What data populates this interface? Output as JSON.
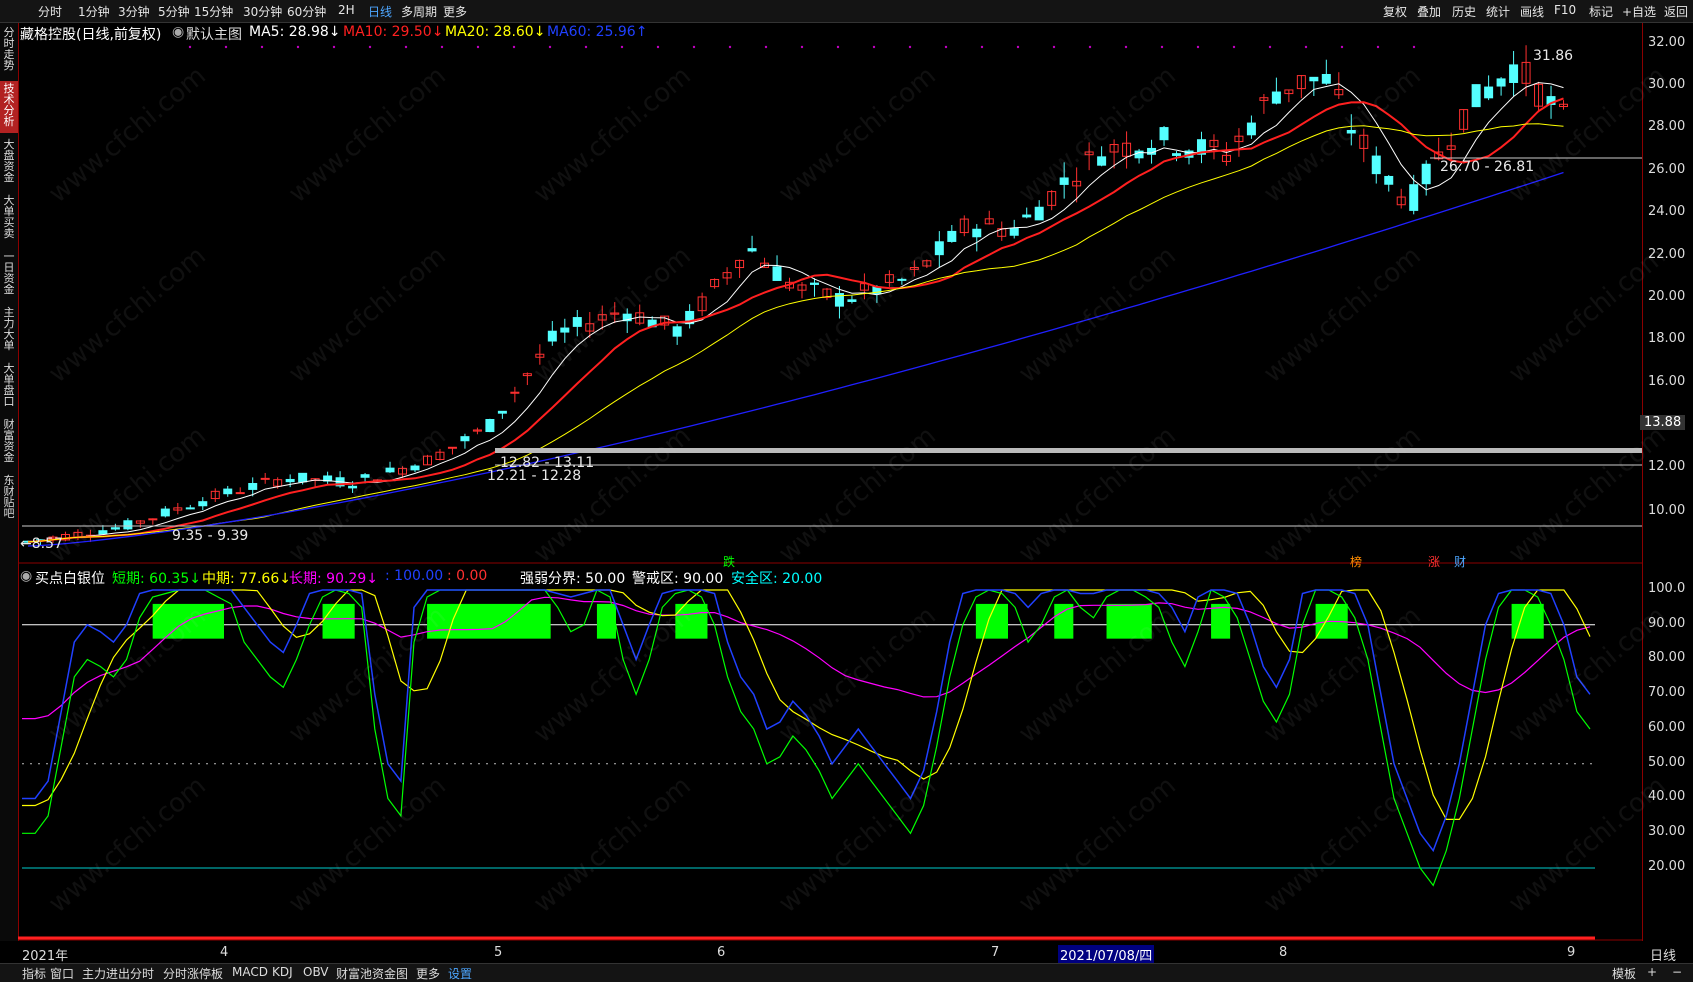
{
  "toolbar": {
    "left_items": [
      "分时",
      "1分钟",
      "3分钟",
      "5分钟",
      "15分钟",
      "30分钟",
      "60分钟",
      "2H",
      "日线",
      "多周期",
      "更多"
    ],
    "active": "日线",
    "right_items": [
      "复权",
      "叠加",
      "历史",
      "统计",
      "画线",
      "F10",
      "标记",
      "+自选",
      "返回"
    ]
  },
  "side_tabs": [
    "分时走势",
    "技术分析",
    "大盘资金",
    "大单买卖",
    "一日资金",
    "主力大单",
    "大单盘口",
    "财富资金",
    "东财贴吧"
  ],
  "side_active": "技术分析",
  "main_header": {
    "stock": "藏格控股(日线,前复权)",
    "chart_name": "默认主图",
    "ma5": "MA5: 28.98↓",
    "ma10": "MA10: 29.50↓",
    "ma20": "MA20: 28.60↓",
    "ma60": "MA60: 25.96↑"
  },
  "sub_header": {
    "name": "买点白银位",
    "short": "短期: 60.35↓",
    "mid": "中期: 77.66↓",
    "long": "长期: 90.29↓",
    "v100": "100.00",
    "v0": ": 0.00",
    "sep": "强弱分界: 50.00",
    "warn": "警戒区: 90.00",
    "safe": "安全区: 20.00"
  },
  "price_axis": [
    "32.00",
    "30.00",
    "28.00",
    "26.00",
    "24.00",
    "22.00",
    "20.00",
    "18.00",
    "16.00",
    "13.88",
    "12.00",
    "10.00"
  ],
  "price_axis_highlight": "13.88",
  "osc_axis": [
    "100.0",
    "90.00",
    "80.00",
    "70.00",
    "60.00",
    "50.00",
    "40.00",
    "30.00",
    "20.00"
  ],
  "annotations": {
    "high": "31.86",
    "low_start": "←8.57",
    "range1": "9.35 - 9.39",
    "range2": "12.21 - 12.28",
    "range3": "12.82 - 13.11",
    "range4": "26.70 - 26.81"
  },
  "events": [
    {
      "text": "跌",
      "color": "#00ff00"
    },
    {
      "text": "榜",
      "color": "#ff8c00"
    },
    {
      "text": "涨",
      "color": "#ff3030"
    },
    {
      "text": "财",
      "color": "#4da6ff"
    }
  ],
  "x_axis": [
    "2021年",
    "4",
    "5",
    "6",
    "7",
    "2021/07/08/四",
    "8",
    "9"
  ],
  "x_axis_right": "日线",
  "bottom_items": [
    "指标",
    "窗口",
    "主力进出分时",
    "分时涨停板",
    "MACD",
    "KDJ",
    "OBV",
    "财富池资金图",
    "更多",
    "设置"
  ],
  "bottom_active": "设置",
  "bottom_right": [
    "模板",
    "+",
    "−"
  ],
  "watermark": "www.cfchi.com",
  "colors": {
    "ma5": "#ffffff",
    "ma10": "#ff2020",
    "ma20": "#ffff00",
    "ma60": "#2020ff",
    "up": "#ff3030",
    "down": "#54ffff",
    "short": "#00ff00",
    "mid": "#ffff00",
    "long": "#ff00ff",
    "block": "#00ff00"
  },
  "chart_data": {
    "type": "candlestick",
    "price_range": [
      8.0,
      32.5
    ],
    "osc_range": [
      0,
      100
    ],
    "short_term": [
      30,
      30,
      35,
      55,
      75,
      80,
      78,
      75,
      80,
      92,
      98,
      99,
      100,
      100,
      100,
      98,
      96,
      85,
      80,
      75,
      72,
      80,
      90,
      98,
      100,
      99,
      95,
      60,
      40,
      35,
      85,
      98,
      100,
      100,
      100,
      100,
      100,
      100,
      100,
      100,
      100,
      95,
      88,
      90,
      100,
      98,
      80,
      70,
      80,
      95,
      99,
      100,
      98,
      90,
      75,
      65,
      60,
      50,
      52,
      58,
      54,
      48,
      40,
      45,
      50,
      45,
      40,
      35,
      30,
      38,
      55,
      75,
      90,
      98,
      100,
      99,
      95,
      85,
      90,
      98,
      100,
      95,
      92,
      98,
      100,
      100,
      98,
      95,
      85,
      78,
      88,
      100,
      98,
      92,
      80,
      68,
      62,
      70,
      90,
      100,
      100,
      98,
      92,
      80,
      60,
      40,
      30,
      20,
      15,
      25,
      40,
      60,
      80,
      95,
      100,
      100,
      98,
      90,
      80,
      65,
      60
    ]
  }
}
